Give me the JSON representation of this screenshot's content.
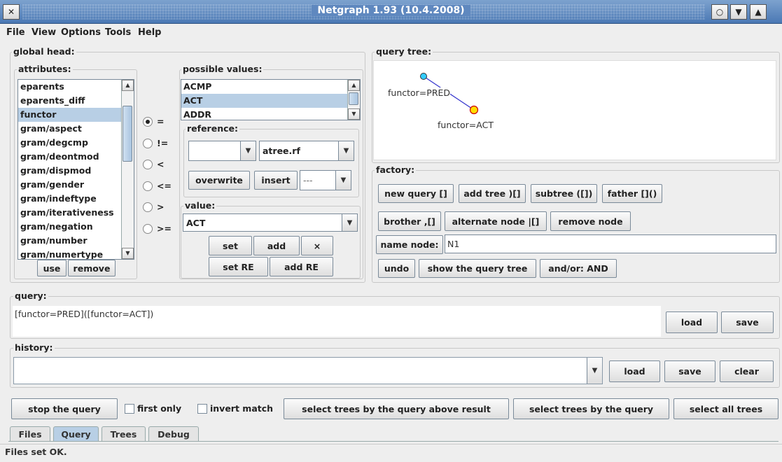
{
  "window": {
    "title": "Netgraph 1.93 (10.4.2008)",
    "close_glyph": "✕",
    "min_glyph": "○",
    "max_glyph": "▼",
    "shade_glyph": "▲"
  },
  "menu": [
    "File",
    "View",
    "Options",
    "Tools",
    "Help"
  ],
  "global_head": {
    "title": "global head:",
    "attributes": {
      "title": "attributes:",
      "items": [
        "eparents",
        "eparents_diff",
        "functor",
        "gram/aspect",
        "gram/degcmp",
        "gram/deontmod",
        "gram/dispmod",
        "gram/gender",
        "gram/indeftype",
        "gram/iterativeness",
        "gram/negation",
        "gram/number",
        "gram/numertype"
      ],
      "selected": "functor"
    },
    "operators": [
      {
        "label": "=",
        "selected": true
      },
      {
        "label": "!=",
        "selected": false
      },
      {
        "label": "<",
        "selected": false
      },
      {
        "label": "<=",
        "selected": false
      },
      {
        "label": ">",
        "selected": false
      },
      {
        "label": ">=",
        "selected": false
      }
    ],
    "use_button": "use",
    "remove_button": "remove",
    "possible_values": {
      "title": "possible values:",
      "items": [
        "ACMP",
        "ACT",
        "ADDR"
      ],
      "selected": "ACT"
    },
    "reference": {
      "title": "reference:",
      "combo1_value": "",
      "combo2_value": "atree.rf",
      "overwrite_button": "overwrite",
      "insert_button": "insert",
      "combo3_value": "---"
    },
    "value": {
      "title": "value:",
      "current": "ACT",
      "set_button": "set",
      "add_button": "add",
      "clear_button": "×",
      "set_re_button": "set RE",
      "add_re_button": "add RE"
    }
  },
  "query_tree": {
    "title": "query tree:",
    "node1_label": "functor=PRED",
    "node2_label": "functor=ACT",
    "node1_color": "#33ccff",
    "node2_color": "#ffdd00",
    "edge_color": "#3333cc"
  },
  "factory": {
    "title": "factory:",
    "new_query": "new query []",
    "add_tree": "add tree )[]",
    "subtree": "subtree ([])",
    "father": "father []()",
    "brother": "brother ,[]",
    "alternate_node": "alternate node |[]",
    "remove_node": "remove node",
    "name_node_label": "name node:",
    "name_node_value": "N1",
    "undo": "undo",
    "show_query_tree": "show the query tree",
    "and_or": "and/or: AND"
  },
  "query": {
    "title": "query:",
    "text": "[functor=PRED]([functor=ACT])",
    "load": "load",
    "save": "save"
  },
  "history": {
    "title": "history:",
    "value": "",
    "load": "load",
    "save": "save",
    "clear": "clear"
  },
  "bottom": {
    "stop_query": "stop the query",
    "first_only": "first only",
    "invert_match": "invert match",
    "select_above_result": "select trees by the query above result",
    "select_by_query": "select trees by the query",
    "select_all": "select all trees"
  },
  "tabs": [
    {
      "label": "Files",
      "active": false
    },
    {
      "label": "Query",
      "active": true
    },
    {
      "label": "Trees",
      "active": false
    },
    {
      "label": "Debug",
      "active": false
    }
  ],
  "status": "Files set OK."
}
